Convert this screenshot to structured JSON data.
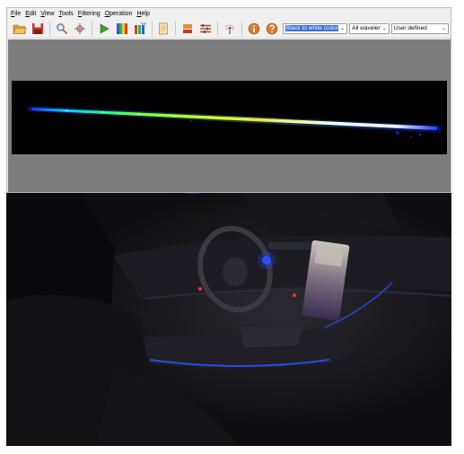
{
  "menu": {
    "items": [
      {
        "label": "File"
      },
      {
        "label": "Edit"
      },
      {
        "label": "View"
      },
      {
        "label": "Tools"
      },
      {
        "label": "Filtering"
      },
      {
        "label": "Operation"
      },
      {
        "label": "Help"
      }
    ]
  },
  "toolbar": {
    "icons": [
      "open-folder-icon",
      "save-icon",
      "magnifier-icon",
      "crosshair-icon",
      "play-icon",
      "spectrum-icon",
      "rgb-icon",
      "document-icon",
      "layers-icon",
      "sliders-icon",
      "signal-icon",
      "info-icon",
      "help-icon"
    ],
    "colormap_select": {
      "value": "Black to white (color)"
    },
    "wavelength_select": {
      "value": "All wavelengths"
    },
    "range_select": {
      "value": "User defined"
    }
  },
  "colors": {
    "accent": "#3a6fd8",
    "viewport_bg": "#7d7d7d"
  }
}
